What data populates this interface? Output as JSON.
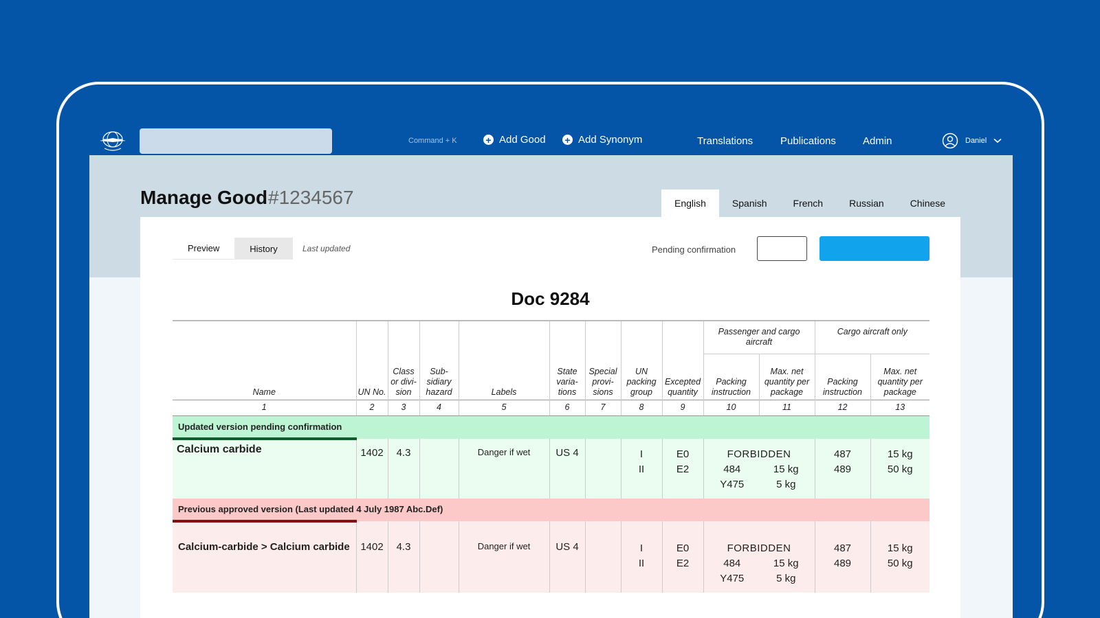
{
  "nav": {
    "search_placeholder": "",
    "shortcut": "Command + K",
    "add_good": "Add Good",
    "add_synonym": "Add Synonym",
    "translations": "Translations",
    "publications": "Publications",
    "admin": "Admin",
    "user": "Daniel"
  },
  "header": {
    "title": "Manage Good",
    "id": "#1234567",
    "languages": [
      "English",
      "Spanish",
      "French",
      "Russian",
      "Chinese"
    ],
    "active_language": "English"
  },
  "toolbar": {
    "preview": "Preview",
    "history": "History",
    "last_updated": "Last updated",
    "pending_label": "Pending confirmation",
    "pending_value": ""
  },
  "doc_title": "Doc 9284",
  "table": {
    "headers": {
      "name": "Name",
      "un_no": "UN No.",
      "class": "Class or divi- sion",
      "subsidiary": "Sub- sidiary hazard",
      "labels": "Labels",
      "state": "State varia- tions",
      "special": "Special provi- sions",
      "packing_group": "UN packing group",
      "excepted": "Excepted quantity",
      "passenger_group": "Passenger and cargo aircraft",
      "cargo_group": "Cargo aircraft only",
      "packing_instruction": "Packing instruction",
      "max_net": "Max. net quantity per package"
    },
    "column_numbers": [
      "1",
      "2",
      "3",
      "4",
      "5",
      "6",
      "7",
      "8",
      "9",
      "10",
      "11",
      "12",
      "13"
    ],
    "sign": "≠",
    "pending": {
      "banner": "Updated version pending confirmation",
      "name": "Calcium carbide",
      "un_no": "1402",
      "class": "4.3",
      "subsidiary": "",
      "labels": "Danger if wet",
      "state": "US 4",
      "special": "",
      "packing_group": [
        "I",
        "II"
      ],
      "excepted": [
        "E0",
        "E2"
      ],
      "forbidden": "FORBIDDEN",
      "pax_packing": [
        "484",
        "Y475"
      ],
      "pax_max": [
        "15 kg",
        "5 kg"
      ],
      "cargo_packing": [
        "487",
        "489"
      ],
      "cargo_max": [
        "15 kg",
        "50 kg"
      ]
    },
    "previous": {
      "banner": "Previous approved version  (Last updated 4 July 1987 Abc.Def)",
      "name": "Calcium-carbide > Calcium carbide",
      "un_no": "1402",
      "class": "4.3",
      "subsidiary": "",
      "labels": "Danger if wet",
      "state": "US 4",
      "special": "",
      "packing_group": [
        "I",
        "II"
      ],
      "excepted": [
        "E0",
        "E2"
      ],
      "forbidden": "FORBIDDEN",
      "pax_packing": [
        "484",
        "Y475"
      ],
      "pax_max": [
        "15 kg",
        "5 kg"
      ],
      "cargo_packing": [
        "487",
        "489"
      ],
      "cargo_max": [
        "15 kg",
        "50 kg"
      ]
    }
  },
  "colors": {
    "brand_blue": "#0455a8",
    "confirm_button": "#11a4ec",
    "pending_banner": "#bdf4d3",
    "previous_banner": "#fcc8c8"
  }
}
